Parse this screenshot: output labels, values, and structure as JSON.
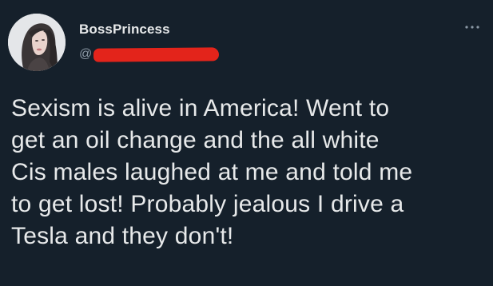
{
  "tweet": {
    "display_name": "BossPrincess",
    "handle_prefix": "@",
    "text": "Sexism is alive in America! Went to\nget an oil change and the all white\nCis males laughed at me and told me\nto get lost! Probably jealous I drive a\nTesla and they don't!",
    "more_icon": "more-horizontal-icon"
  },
  "colors": {
    "background": "#15202b",
    "primary_text": "#e7e9ea",
    "secondary_text": "#8b98a5",
    "redaction": "#e3241b"
  }
}
